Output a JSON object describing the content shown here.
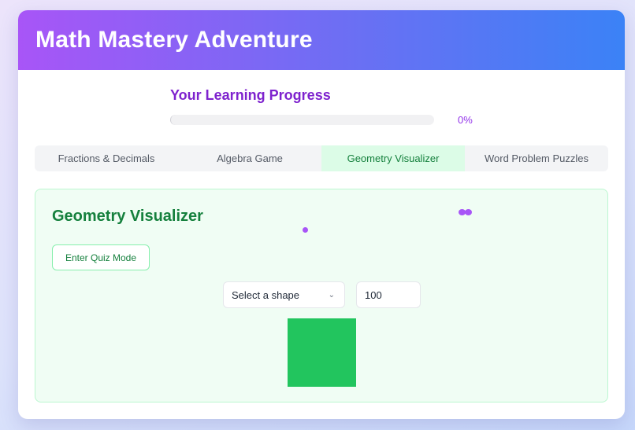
{
  "header": {
    "title": "Math Mastery Adventure"
  },
  "progress": {
    "title": "Your Learning Progress",
    "percent_label": "0%",
    "percent_value": 0
  },
  "tabs": [
    {
      "label": "Fractions & Decimals",
      "active": false
    },
    {
      "label": "Algebra Game",
      "active": false
    },
    {
      "label": "Geometry Visualizer",
      "active": true
    },
    {
      "label": "Word Problem Puzzles",
      "active": false
    }
  ],
  "panel": {
    "title": "Geometry Visualizer",
    "quiz_button_label": "Enter Quiz Mode",
    "shape_select": {
      "selected": "Select a shape"
    },
    "size_input": {
      "value": "100"
    }
  },
  "colors": {
    "header_gradient_start": "#a855f7",
    "header_gradient_end": "#3b82f6",
    "accent_purple": "#a855f7",
    "accent_green": "#22c55e",
    "active_tab_bg": "#dcfce7"
  },
  "icons": {
    "select_chevron": "chevron-down-icon"
  }
}
